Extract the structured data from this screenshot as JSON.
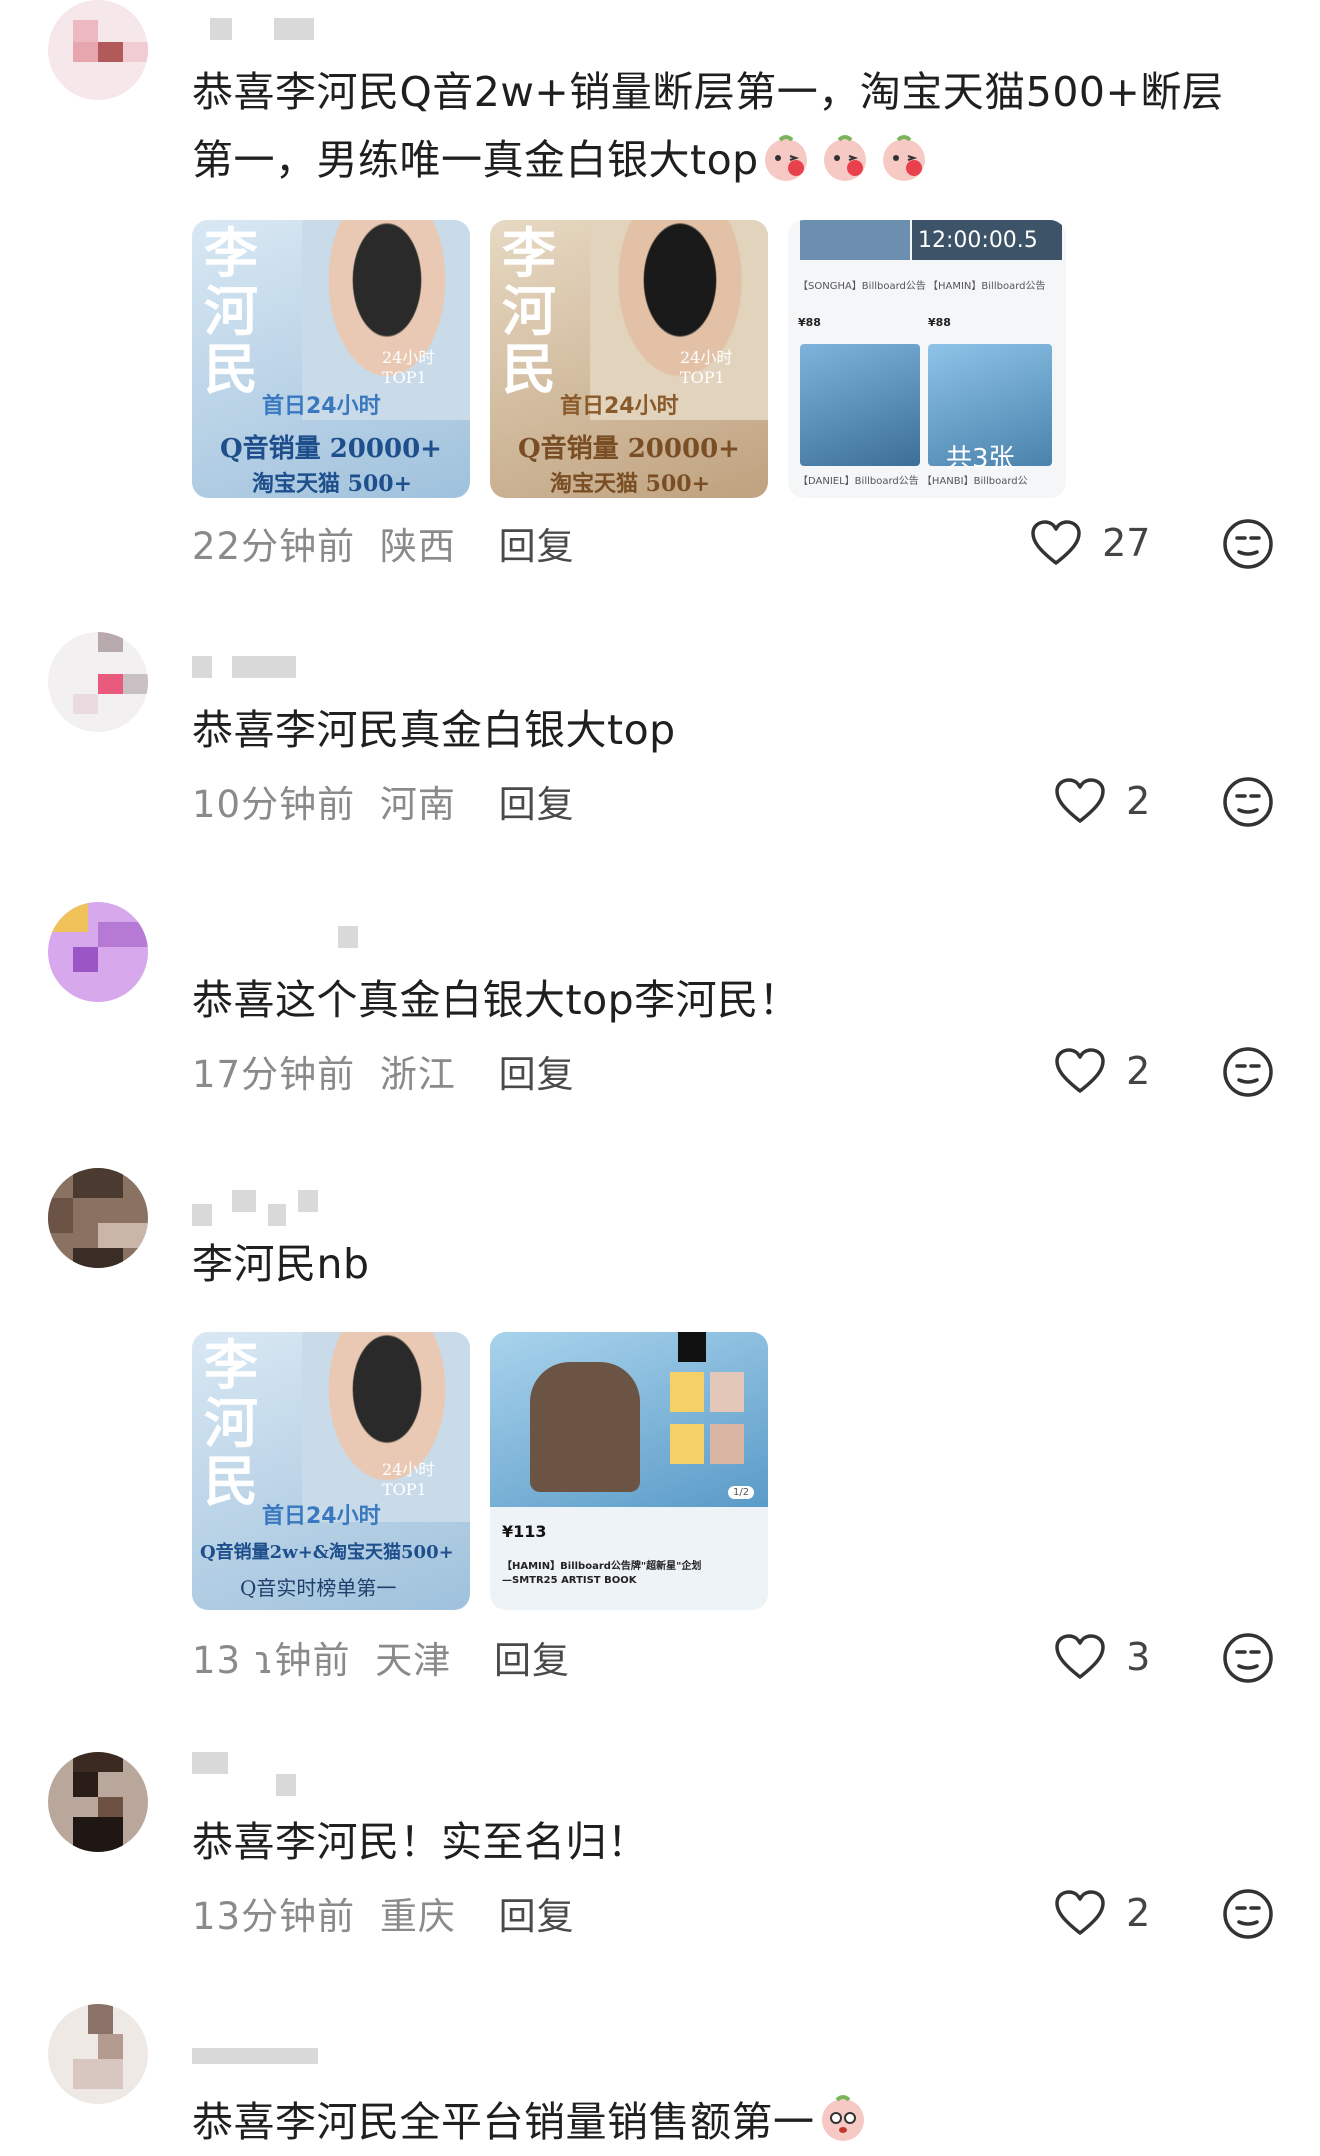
{
  "comments": [
    {
      "text": "恭喜李河民Q音2w+销量断层第一，淘宝天猫500+断层第一，男练唯一真金白银大top",
      "time": "22分钟前",
      "location": "陕西",
      "reply": "回复",
      "likes": "27",
      "thumbs": [
        {
          "name": "李河民",
          "caption": "首日24小时",
          "sales": "Q音销量 20000+",
          "tmall": "淘宝天猫 500+",
          "badge": "24小时 TOP1"
        },
        {
          "name": "李河民",
          "caption": "首日24小时",
          "sales": "Q音销量 20000+",
          "tmall": "淘宝天猫 500+",
          "badge": "24小时 TOP1"
        },
        {
          "time": "12:00:00.5",
          "count": "共3张",
          "p1": "¥88",
          "p2": "¥88"
        }
      ]
    },
    {
      "text": "恭喜李河民真金白银大top",
      "time": "10分钟前",
      "location": "河南",
      "reply": "回复",
      "likes": "2"
    },
    {
      "text": "恭喜这个真金白银大top李河民！",
      "time": "17分钟前",
      "location": "浙江",
      "reply": "回复",
      "likes": "2"
    },
    {
      "text": "李河民nb",
      "time": "13 ɿ钟前",
      "location": "天津",
      "reply": "回复",
      "likes": "3",
      "thumbs": [
        {
          "name": "李河民",
          "caption": "首日24小时",
          "sales": "Q音销量2w+&淘宝天猫500+",
          "rank": "Q音实时榜单第一",
          "badge": "24小时 TOP1"
        },
        {
          "price": "¥113",
          "desc": "【HAMIN】Billboard公告牌\"超新星\"企划—SMTR25 ARTIST BOOK",
          "page": "1/2"
        }
      ]
    },
    {
      "text": "恭喜李河民！实至名归！",
      "time": "13分钟前",
      "location": "重庆",
      "reply": "回复",
      "likes": "2"
    },
    {
      "text": "恭喜李河民全平台销量销售额第一"
    }
  ],
  "icons": {
    "like": "heart-outline-icon",
    "react": "neutral-face-icon",
    "emoji": "peach-blush-emoji"
  }
}
